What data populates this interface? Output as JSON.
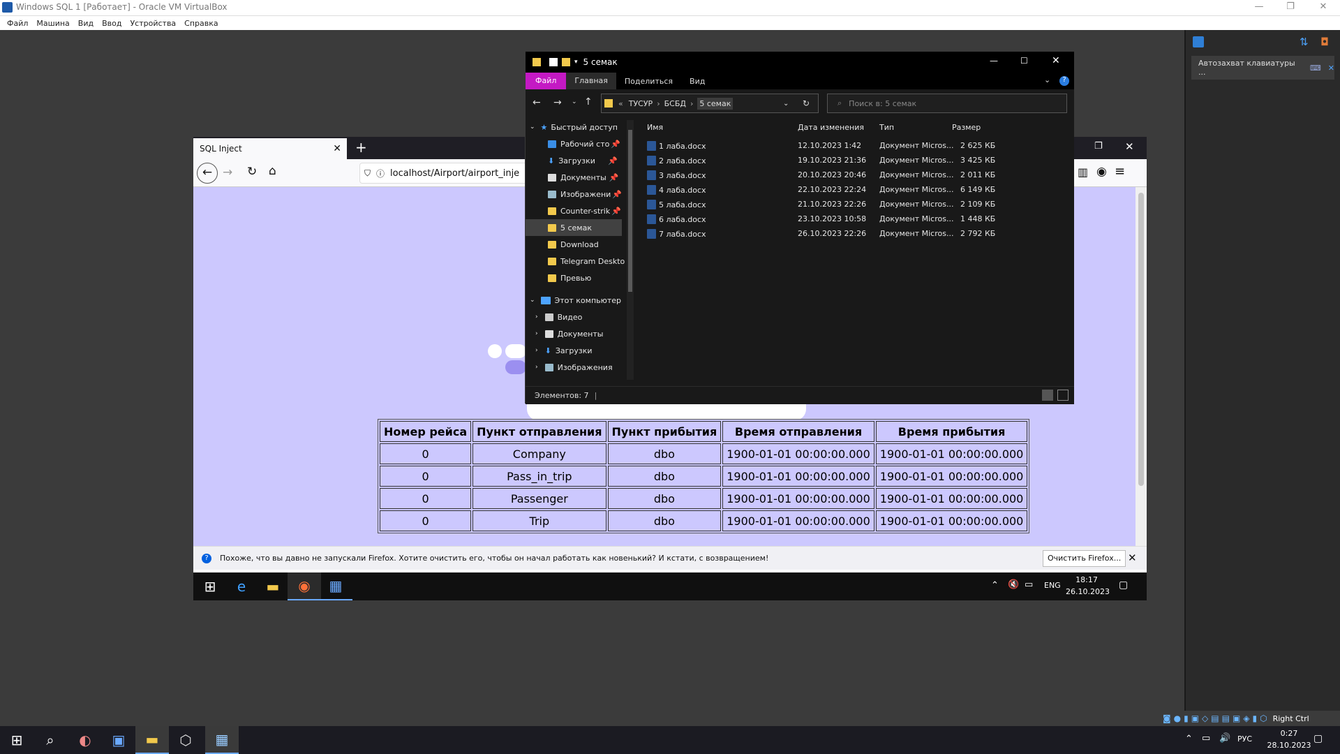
{
  "host": {
    "title": "Windows SQL 1 [Работает] - Oracle VM VirtualBox",
    "menu": [
      "Файл",
      "Машина",
      "Вид",
      "Ввод",
      "Устройства",
      "Справка"
    ],
    "notification": "Автозахват клавиатуры ...",
    "status_key": "Right Ctrl",
    "tray": {
      "lang": "РУС",
      "time": "0:27",
      "date": "28.10.2023"
    }
  },
  "browser": {
    "tab_title": "SQL Inject",
    "url": "localhost/Airport/airport_inje",
    "notification": "Похоже, что вы давно не запускали Firefox. Хотите очистить его, чтобы он начал работать как новенький? И кстати, с возвращением!",
    "refresh_button": "Очистить Firefox..."
  },
  "table": {
    "headers": [
      "Номер рейса",
      "Пункт отправления",
      "Пункт прибытия",
      "Время отправления",
      "Время прибытия"
    ],
    "rows": [
      [
        "0",
        "Company",
        "dbo",
        "1900-01-01 00:00:00.000",
        "1900-01-01 00:00:00.000"
      ],
      [
        "0",
        "Pass_in_trip",
        "dbo",
        "1900-01-01 00:00:00.000",
        "1900-01-01 00:00:00.000"
      ],
      [
        "0",
        "Passenger",
        "dbo",
        "1900-01-01 00:00:00.000",
        "1900-01-01 00:00:00.000"
      ],
      [
        "0",
        "Trip",
        "dbo",
        "1900-01-01 00:00:00.000",
        "1900-01-01 00:00:00.000"
      ]
    ]
  },
  "explorer": {
    "title": "5 семак",
    "ribbon": [
      "Файл",
      "Главная",
      "Поделиться",
      "Вид"
    ],
    "path": [
      "«",
      "ТУСУР",
      "БСБД",
      "5 семак"
    ],
    "search_placeholder": "Поиск в: 5 семак",
    "nav": {
      "quick_access": "Быстрый доступ",
      "quick": [
        "Рабочий сто",
        "Загрузки",
        "Документы",
        "Изображени",
        "Counter-strik",
        "5 семак",
        "Download",
        "Telegram Deskto",
        "Превью"
      ],
      "this_pc": "Этот компьютер",
      "pc": [
        "Видео",
        "Документы",
        "Загрузки",
        "Изображения"
      ]
    },
    "columns": [
      "Имя",
      "Дата изменения",
      "Тип",
      "Размер"
    ],
    "files": [
      [
        "1 лаба.docx",
        "12.10.2023 1:42",
        "Документ Micros...",
        "2 625 КБ"
      ],
      [
        "2 лаба.docx",
        "19.10.2023 21:36",
        "Документ Micros...",
        "3 425 КБ"
      ],
      [
        "3 лаба.docx",
        "20.10.2023 20:46",
        "Документ Micros...",
        "2 011 КБ"
      ],
      [
        "4 лаба.docx",
        "22.10.2023 22:24",
        "Документ Micros...",
        "6 149 КБ"
      ],
      [
        "5 лаба.docx",
        "21.10.2023 22:26",
        "Документ Micros...",
        "2 109 КБ"
      ],
      [
        "6 лаба.docx",
        "23.10.2023 10:58",
        "Документ Micros...",
        "1 448 КБ"
      ],
      [
        "7 лаба.docx",
        "26.10.2023 22:26",
        "Документ Micros...",
        "2 792 КБ"
      ]
    ],
    "status": "Элементов: 7"
  },
  "guest_tray": {
    "lang": "ENG",
    "time": "18:17",
    "date": "26.10.2023"
  }
}
